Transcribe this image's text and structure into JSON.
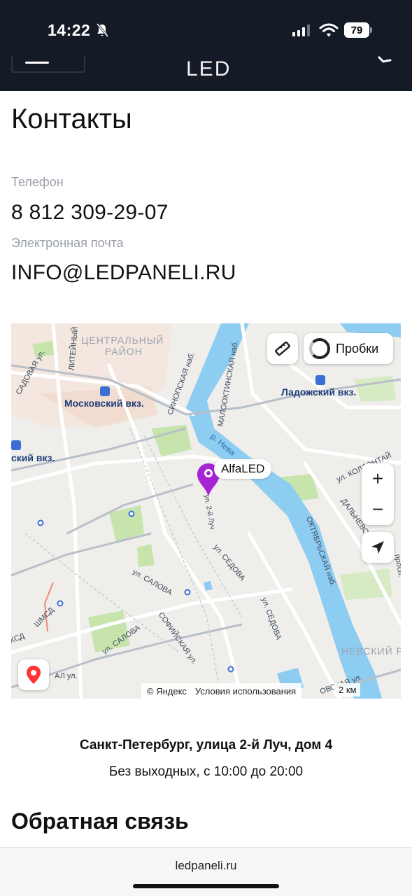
{
  "status_bar": {
    "time": "14:22",
    "battery": "79"
  },
  "header": {
    "logo": "LED"
  },
  "contacts": {
    "title": "Контакты",
    "phone_label": "Телефон",
    "phone": "8 812 309-29-07",
    "email_label": "Электронная почта",
    "email": "INFO@LEDPANELI.RU"
  },
  "map": {
    "traffic_label": "Пробки",
    "marker_label": "AlfaLED",
    "copyright": "© Яндекс",
    "terms": "Условия использования",
    "scale": "2 км",
    "labels": {
      "district": "ЦЕНТРАЛЬНЫЙ РАЙОН",
      "district_line1": "ЦЕНТРАЛЬНЫЙ",
      "district_line2": "РАЙОН",
      "moskovsky": "Московский вкз.",
      "ladozhsky": "Ладожский вкз.",
      "vkz": "ский вкз.",
      "nevsky": "НЕВСКИЙ Р",
      "river": "р. Нева",
      "sinopskaya": "СИНОПСКАЯ наб.",
      "malookhtinskaya": "МАЛООХТИНСКАЯ наб.",
      "oktyabrskaya": "ОКТЯБРЬСКАЯ наб.",
      "liteyny": "ЛИТЕЙНЫЙ",
      "sadovaya": "САДОВАЯ ул.",
      "ul_2y_luch": "ул. 2-й Луч",
      "ul_sedova1": "ул. СЕДОВА",
      "ul_sedova2": "ул. СЕДОВА",
      "ul_salova1": "ул. САЛОВА",
      "ul_salova2": "ул. САЛОВА",
      "sofiyskaya": "СОФИЙСКАЯ ул.",
      "kollontai": "ул. КОЛЛОНТАЙ",
      "dalnevostochny": "ДАЛЬНЕВОСТ",
      "prosp": "просп.",
      "shmsd": "ШМСД",
      "ksd": "КСД",
      "al_ul": "АЛ ул.",
      "ovskaya": "ОВСКАЯ ул."
    }
  },
  "address": "Санкт-Петербург, улица 2-й Луч, дом 4",
  "hours": "Без выходных, с 10:00 до 20:00",
  "feedback_title": "Обратная связь",
  "browser": {
    "url": "ledpaneli.ru"
  },
  "colors": {
    "header_bg": "#141a26",
    "river": "#8ecdf2",
    "park": "#c7e4ad",
    "marker": "#a524d6"
  }
}
